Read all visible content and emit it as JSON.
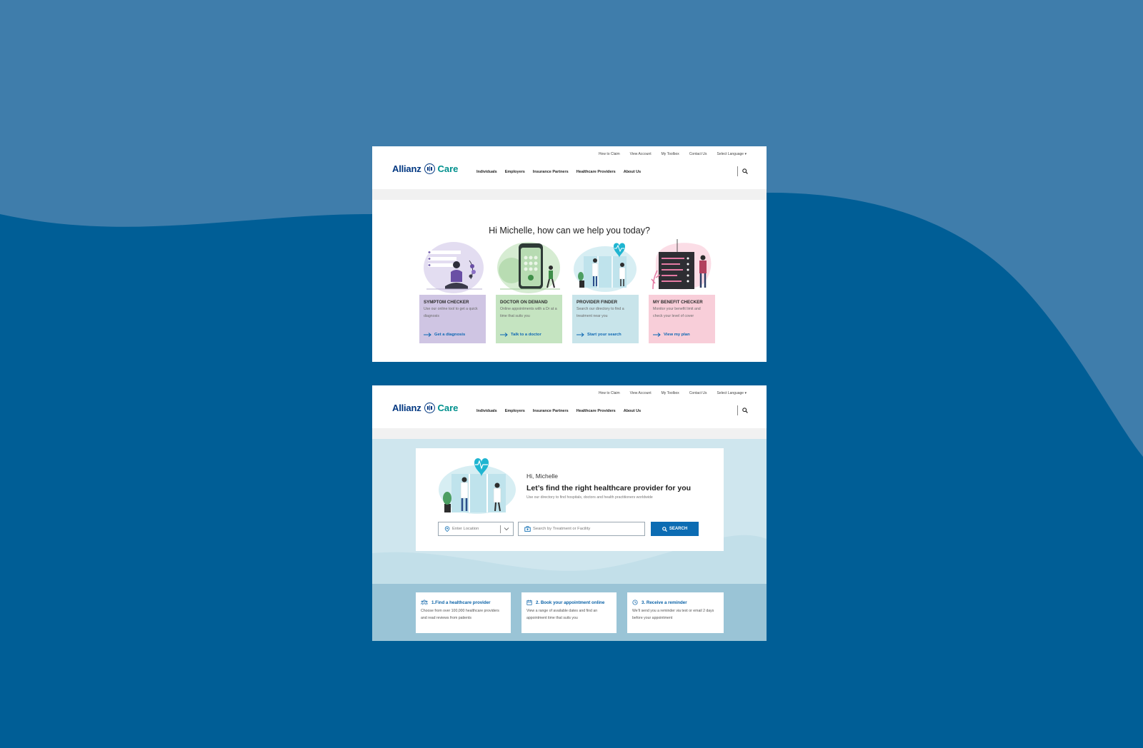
{
  "colors": {
    "page_bg": "#005e96",
    "page_bg_light": "#3f7dab",
    "brand_blue": "#003781",
    "care_teal": "#00908d",
    "link_blue": "#0d67b3",
    "button_blue": "#0c6cb3"
  },
  "header": {
    "brand": "Allianz",
    "brand_suffix": "Care",
    "utility_links": [
      "How to Claim",
      "View Account",
      "My Toolbox",
      "Contact Us",
      "Select Language"
    ],
    "nav": [
      "Individuals",
      "Employers",
      "Insurance Partners",
      "Healthcare Providers",
      "About Us"
    ],
    "search_icon": "search-icon"
  },
  "dashboard": {
    "greeting": "Hi Michelle, how can we help you today?",
    "cards": [
      {
        "title": "SYMPTOM CHECKER",
        "desc": "Use our online tool to get a quick diagnosis",
        "cta": "Get a diagnosis",
        "color": "#cfc5e3"
      },
      {
        "title": "DOCTOR ON DEMAND",
        "desc": "Online appointments with a Dr at a time that suits you",
        "cta": "Talk to a doctor",
        "color": "#c5e4c1"
      },
      {
        "title": "PROVIDER FINDER",
        "desc": "Search our directory to find a treatment near you",
        "cta": "Start your search",
        "color": "#c8e4ea"
      },
      {
        "title": "MY BENEFIT CHECKER",
        "desc": "Monitor your benefit limit and check your level of cover",
        "cta": "View my plan",
        "color": "#f8ced9"
      }
    ]
  },
  "provider_finder": {
    "hi": "Hi, Michelle",
    "headline": "Let’s find the right healthcare provider for you",
    "sub": "Use our directory to find hospitals, doctors and health practitioners worldwide",
    "location_placeholder": "Enter Location",
    "query_placeholder": "Search by Treatment or Facility",
    "search_button": "SEARCH",
    "steps": [
      {
        "title": "1.Find a healthcare provider",
        "desc": "Choose from over 100,000 healthcare providers and read reviews from patients",
        "icon": "people-icon"
      },
      {
        "title": "2. Book your appointment online",
        "desc": "View a range of available dates and find an appointment time that suits you",
        "icon": "calendar-icon"
      },
      {
        "title": "3. Receive a reminder",
        "desc": "We’ll send you a reminder via text or email 2 days before your appointment",
        "icon": "clock-icon"
      }
    ]
  }
}
